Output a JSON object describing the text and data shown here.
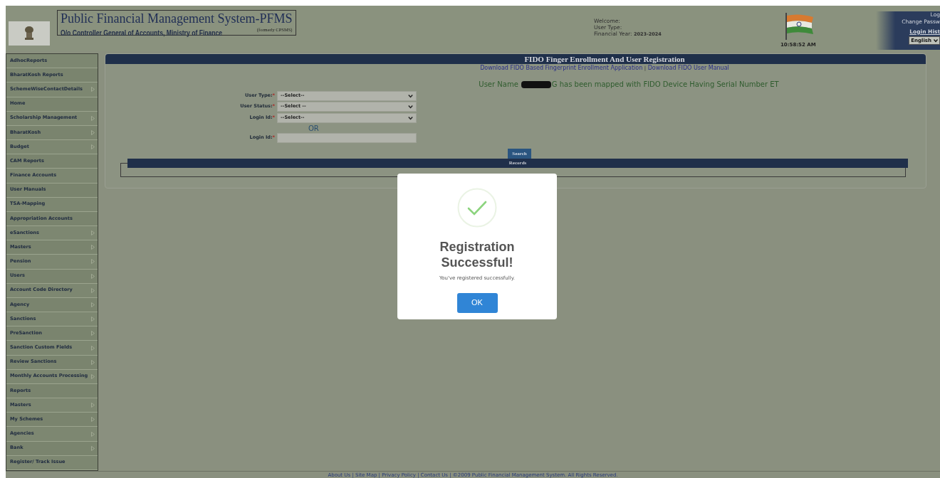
{
  "header": {
    "title": "Public Financial Management System-PFMS",
    "formerly": "(formerly CPSMS)",
    "subtitle": "O/o Controller General of Accounts, Ministry of Finance",
    "welcome": "Welcome:",
    "user_type": "User Type:",
    "financial_year_label": "Financial Year:",
    "financial_year": "2023-2024",
    "time": "10:58:52 AM",
    "links": [
      "Log",
      "Change Passw",
      "Login Hist"
    ],
    "language": "English"
  },
  "sidebar": {
    "items": [
      {
        "label": "AdhocReports",
        "has_submenu": false
      },
      {
        "label": "BharatKosh Reports",
        "has_submenu": false
      },
      {
        "label": "SchemeWiseContactDetails",
        "has_submenu": true
      },
      {
        "label": "Home",
        "has_submenu": false
      },
      {
        "label": "Scholarship Management",
        "has_submenu": true
      },
      {
        "label": "BharatKosh",
        "has_submenu": true
      },
      {
        "label": "Budget",
        "has_submenu": true
      },
      {
        "label": "CAM Reports",
        "has_submenu": false
      },
      {
        "label": "Finance Accounts",
        "has_submenu": false
      },
      {
        "label": "User Manuals",
        "has_submenu": false
      },
      {
        "label": "TSA-Mapping",
        "has_submenu": false
      },
      {
        "label": "Appropriation Accounts",
        "has_submenu": false
      },
      {
        "label": "eSanctions",
        "has_submenu": true
      },
      {
        "label": "Masters",
        "has_submenu": true
      },
      {
        "label": "Pension",
        "has_submenu": true
      },
      {
        "label": "Users",
        "has_submenu": true
      },
      {
        "label": "Account Code Directory",
        "has_submenu": true
      },
      {
        "label": "Agency",
        "has_submenu": true
      },
      {
        "label": "Sanctions",
        "has_submenu": true
      },
      {
        "label": "PreSanction",
        "has_submenu": true
      },
      {
        "label": "Sanction Custom Fields",
        "has_submenu": true
      },
      {
        "label": "Review Sanctions",
        "has_submenu": true
      },
      {
        "label": "Monthly Accounts Processing",
        "has_submenu": true
      },
      {
        "label": "Reports",
        "has_submenu": false
      },
      {
        "label": "Masters",
        "has_submenu": true
      },
      {
        "label": "My Schemes",
        "has_submenu": true
      },
      {
        "label": "Agencies",
        "has_submenu": true
      },
      {
        "label": "Bank",
        "has_submenu": true
      },
      {
        "label": "Register/ Track Issue",
        "has_submenu": false
      }
    ]
  },
  "main": {
    "title": "FIDO Finger Enrollment And User Registration",
    "downloads": [
      "Download FIDO Based Fingerprint Enrollment Application",
      "Download FIDO User Manual"
    ],
    "separator": "|",
    "message_before": "User Name",
    "message_after": "G has been mapped with FIDO Device Having Serial Number ET",
    "fields": [
      {
        "kind": "select",
        "label": "User Type:",
        "required_mark": "*",
        "value": "--Select--"
      },
      {
        "kind": "select",
        "label": "User Status:",
        "required_mark": "*",
        "value": "--Select --"
      },
      {
        "kind": "select",
        "label": "Login Id:",
        "required_mark": "*",
        "value": "--Select--"
      },
      {
        "kind": "or",
        "label": "OR"
      },
      {
        "kind": "text",
        "label": "Login Id:",
        "required_mark": "*"
      }
    ],
    "search_button": "Search",
    "records_title": "Records"
  },
  "footer": {
    "links": [
      "About Us",
      "Site Map",
      "Privacy Policy",
      "Contact Us"
    ],
    "separator": "|",
    "copyright": "©2009 Public Financial Management System. All Rights Reserved."
  },
  "modal": {
    "title": "Registration Successful!",
    "text": "You've registered successfully.",
    "button": "OK"
  }
}
